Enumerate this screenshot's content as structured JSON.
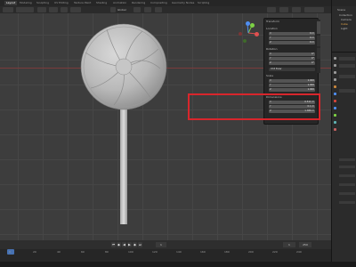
{
  "workspace_tabs": [
    "Layout",
    "Modeling",
    "Sculpting",
    "UV Editing",
    "Texture Paint",
    "Shading",
    "Animation",
    "Rendering",
    "Compositing",
    "Geometry Nodes",
    "Scripting"
  ],
  "header": {
    "view_mode": "Global"
  },
  "n_panel": {
    "title": "Transform",
    "location": {
      "label": "Location",
      "x": "0 m",
      "y": "0 m",
      "z": "0 m"
    },
    "rotation": {
      "label": "Rotation",
      "x": "0°",
      "y": "0°",
      "z": "0°",
      "mode": "XYZ Euler"
    },
    "scale": {
      "label": "Scale",
      "x": "1.000",
      "y": "1.000",
      "z": "1.000"
    },
    "dimensions": {
      "label": "Dimensions",
      "x": "0.511 m",
      "y": "0.1 m",
      "z": "1.386 m"
    }
  },
  "axis_labels": {
    "x": "X",
    "y": "Y",
    "z": "Z"
  },
  "right_editor": {
    "header": "Scene",
    "items": [
      "Collection",
      "Camera",
      "Cube",
      "Light"
    ]
  },
  "timeline": {
    "frames": [
      "0",
      "20",
      "40",
      "60",
      "80",
      "100",
      "120",
      "140",
      "160",
      "180",
      "200",
      "220",
      "240"
    ],
    "start": "1",
    "end": "250",
    "current": "1"
  },
  "colors": {
    "highlight": "#d8262c",
    "x_axis": "#e05050",
    "y_axis": "#7dd144",
    "z_axis": "#4f8ef0",
    "accent": "#4772b3"
  }
}
